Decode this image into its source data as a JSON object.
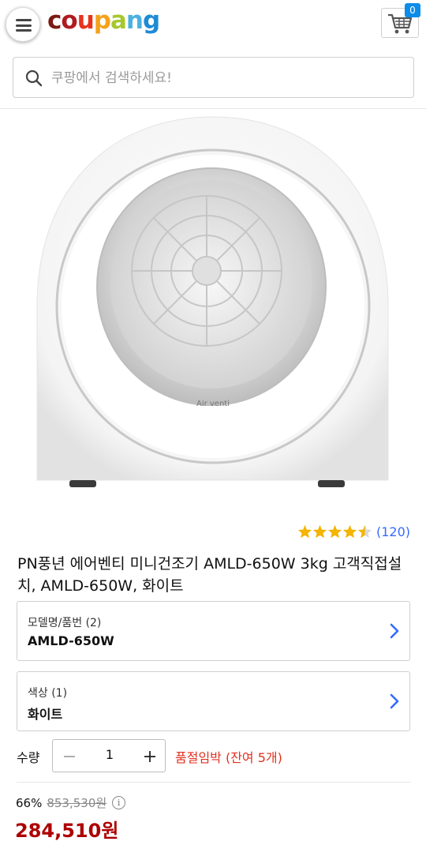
{
  "header": {
    "logo_letters": [
      {
        "ch": "c",
        "cls": "c1"
      },
      {
        "ch": "o",
        "cls": "c2"
      },
      {
        "ch": "u",
        "cls": "c3"
      },
      {
        "ch": "p",
        "cls": "c4"
      },
      {
        "ch": "a",
        "cls": "c5"
      },
      {
        "ch": "n",
        "cls": "c6"
      },
      {
        "ch": "g",
        "cls": "c7"
      }
    ],
    "cart_count": "0",
    "menu_icon": "hamburger-icon",
    "cart_icon": "cart-icon"
  },
  "search": {
    "placeholder": "쿠팡에서 검색하세요!",
    "icon": "search-icon"
  },
  "product": {
    "brand_text_on_image": "Air venti",
    "rating_stars": 4.5,
    "rating_count": "(120)",
    "title": "PN풍년 에어벤티 미니건조기 AMLD-650W 3kg 고객직접설치, AMLD-650W, 화이트"
  },
  "options": [
    {
      "label": "모델명/품번 (2)",
      "value": "AMLD-650W"
    },
    {
      "label": "색상 (1)",
      "value": "화이트"
    }
  ],
  "quantity": {
    "label": "수량",
    "value": "1",
    "stock_note": "품절임박 (잔여 5개)"
  },
  "price": {
    "discount_rate": "66%",
    "original_price": "853,530원",
    "info_icon": "i",
    "sale_price": "284,510원"
  },
  "colors": {
    "accent_blue": "#346aff",
    "badge_blue": "#0c8ce9",
    "alert_red": "#e1301f",
    "price_red": "#ae0000",
    "star_gold": "#f4b400"
  }
}
